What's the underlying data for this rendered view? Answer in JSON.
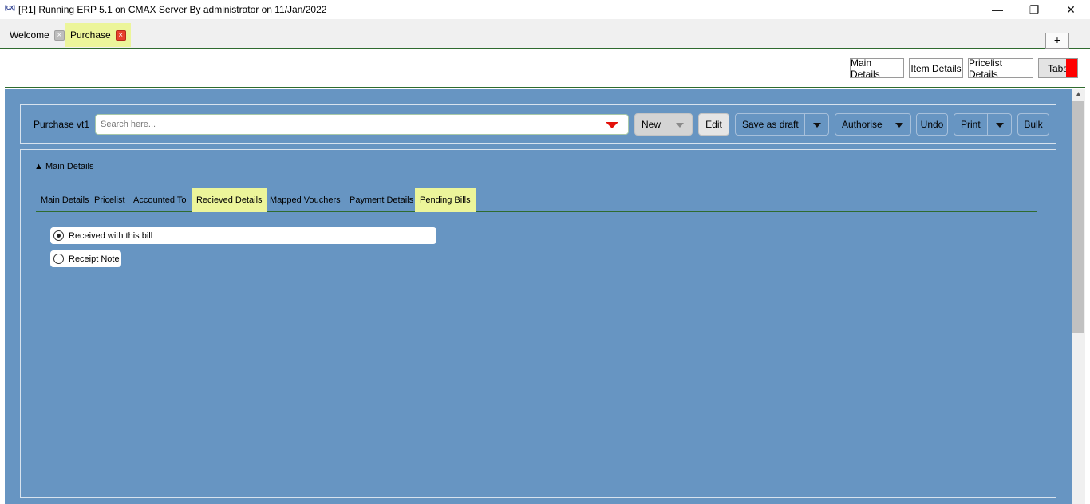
{
  "window": {
    "app_icon_text": "[CX]",
    "title": "[R1] Running ERP 5.1 on CMAX Server By administrator on 11/Jan/2022",
    "min_glyph": "—",
    "max_glyph": "❐",
    "close_glyph": "✕"
  },
  "doc_tabs": [
    {
      "label": "Welcome",
      "close_glyph": "×",
      "active": false
    },
    {
      "label": "Purchase",
      "close_glyph": "×",
      "active": true
    }
  ],
  "add_tab_label": "+",
  "top_buttons": {
    "main_details": "Main Details",
    "item_details": "Item Details",
    "pricelist_details": "Pricelist Details",
    "tabs": "Tabs"
  },
  "toolbar": {
    "voucher_label": "Purchase vt1",
    "search_placeholder": "Search here...",
    "new": "New",
    "edit": "Edit",
    "save_as_draft": "Save as draft",
    "authorise": "Authorise",
    "undo": "Undo",
    "print": "Print",
    "bulk": "Bulk"
  },
  "section": {
    "title": "▲ Main Details"
  },
  "subtabs": [
    {
      "label": "Main Details",
      "highlighted": false
    },
    {
      "label": "Pricelist",
      "highlighted": false
    },
    {
      "label": "Accounted To",
      "highlighted": false
    },
    {
      "label": "Recieved Details",
      "highlighted": true
    },
    {
      "label": "Mapped Vouchers",
      "highlighted": false
    },
    {
      "label": "Payment Details",
      "highlighted": false
    },
    {
      "label": "Pending Bills",
      "highlighted": true
    }
  ],
  "receipt_options": [
    {
      "label": "Received with this bill",
      "selected": true
    },
    {
      "label": "Receipt Note",
      "selected": false
    }
  ],
  "colors": {
    "panel_blue": "#6795c2",
    "highlight_yellow": "#ecf59a",
    "accent_red": "#e3120b",
    "divider_green": "#2f6b2f"
  }
}
